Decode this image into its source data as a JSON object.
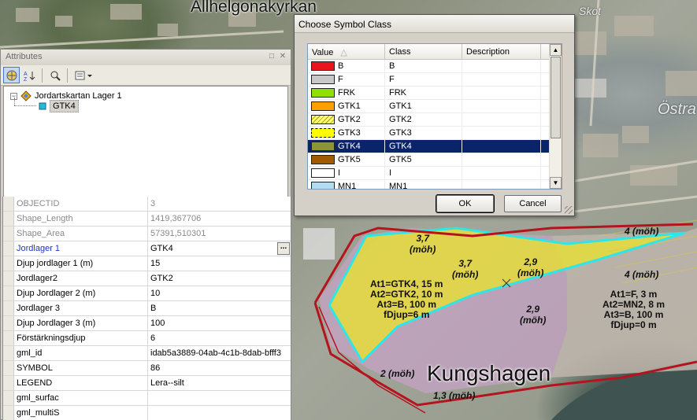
{
  "map": {
    "labels": {
      "church": "Allhelgonakyrkan",
      "skot": "Skot",
      "ostra": "Östra",
      "district": "Kungshagen",
      "a1": "3,7\n(möh)",
      "a2": "3,7\n(möh)",
      "a3": "2,9\n(möh)",
      "a4": "4 (möh)",
      "a5": "4 (möh)",
      "a6": "2,9\n(möh)",
      "a7": "2 (möh)",
      "a8": "1,3 (möh)",
      "b1": "At1=GTK4, 15 m\nAt2=GTK2, 10 m\nAt3=B, 100 m\nfDjup=6 m",
      "b2": "At1=F, 3 m\nAt2=MN2, 8 m\nAt3=B, 100 m\nfDjup=0 m"
    },
    "colors": {
      "yellow_zone": "#e8e033",
      "pink_zone": "#c7a3c7",
      "outline_red": "#b4141e",
      "outline_cyan": "#2fe6e6"
    }
  },
  "attributes": {
    "title": "Attributes",
    "tree": {
      "layer": "Jordartskartan Lager 1",
      "feature": "GTK4"
    },
    "rows": [
      {
        "name": "OBJECTID",
        "value": "3",
        "readonly": true
      },
      {
        "name": "Shape_Length",
        "value": "1419,367706",
        "readonly": true
      },
      {
        "name": "Shape_Area",
        "value": "57391,510301",
        "readonly": true
      },
      {
        "name": "Jordlager 1",
        "value": "GTK4",
        "link": true,
        "button": "..."
      },
      {
        "name": "Djup jordlager 1 (m)",
        "value": "15"
      },
      {
        "name": "Jordlager2",
        "value": "GTK2"
      },
      {
        "name": "Djup Jordlager 2 (m)",
        "value": "10"
      },
      {
        "name": "Jordlager 3",
        "value": "B"
      },
      {
        "name": "Djup Jordlager 3 (m)",
        "value": "100"
      },
      {
        "name": "Förstärkningsdjup",
        "value": "6"
      },
      {
        "name": "gml_id",
        "value": "idab5a3889-04ab-4c1b-8dab-bfff3"
      },
      {
        "name": "SYMBOL",
        "value": "86"
      },
      {
        "name": "LEGEND",
        "value": "Lera--silt"
      },
      {
        "name": "gml_surfac",
        "value": ""
      },
      {
        "name": "gml_multiS",
        "value": ""
      }
    ]
  },
  "dialog": {
    "title": "Choose Symbol Class",
    "columns": {
      "value": "Value",
      "class": "Class",
      "description": "Description"
    },
    "rows": [
      {
        "value": "B",
        "class": "B",
        "color": "#e8141e",
        "pattern": "solid"
      },
      {
        "value": "F",
        "class": "F",
        "color": "#c8c8c8",
        "pattern": "solid"
      },
      {
        "value": "FRK",
        "class": "FRK",
        "color": "#8fe000",
        "pattern": "solid"
      },
      {
        "value": "GTK1",
        "class": "GTK1",
        "color": "#ffa000",
        "pattern": "solid"
      },
      {
        "value": "GTK2",
        "class": "GTK2",
        "color": "#ffff78",
        "pattern": "hatch"
      },
      {
        "value": "GTK3",
        "class": "GTK3",
        "color": "#ffff00",
        "pattern": "dash"
      },
      {
        "value": "GTK4",
        "class": "GTK4",
        "color": "#8c9632",
        "pattern": "solid",
        "selected": true
      },
      {
        "value": "GTK5",
        "class": "GTK5",
        "color": "#a05a00",
        "pattern": "solid"
      },
      {
        "value": "I",
        "class": "I",
        "color": "#ffffff",
        "pattern": "solid"
      },
      {
        "value": "MN1",
        "class": "MN1",
        "color": "#b4dcf0",
        "pattern": "solid"
      }
    ],
    "ok_label": "OK",
    "cancel_label": "Cancel"
  }
}
